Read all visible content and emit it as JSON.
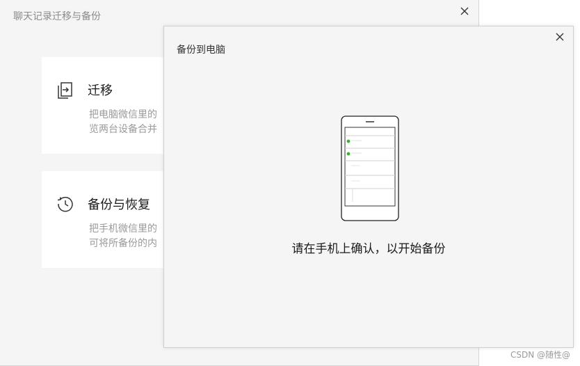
{
  "main_window": {
    "title": "聊天记录迁移与备份",
    "close_icon": "close-icon",
    "cards": [
      {
        "icon": "migrate-icon",
        "title": "迁移",
        "desc_line1": "把电脑微信里的",
        "desc_line2": "览两台设备合并"
      },
      {
        "icon": "history-icon",
        "title": "备份与恢复",
        "desc_line1": "把手机微信里的",
        "desc_line2": "可将所备份的内"
      }
    ]
  },
  "dialog": {
    "title": "备份到电脑",
    "close_icon": "close-icon",
    "illustration": "phone-icon",
    "message": "请在手机上确认，以开始备份"
  },
  "watermark": "CSDN @随性@",
  "colors": {
    "window_bg": "#f5f5f5",
    "card_bg": "#ffffff",
    "check_green": "#3cb034"
  }
}
